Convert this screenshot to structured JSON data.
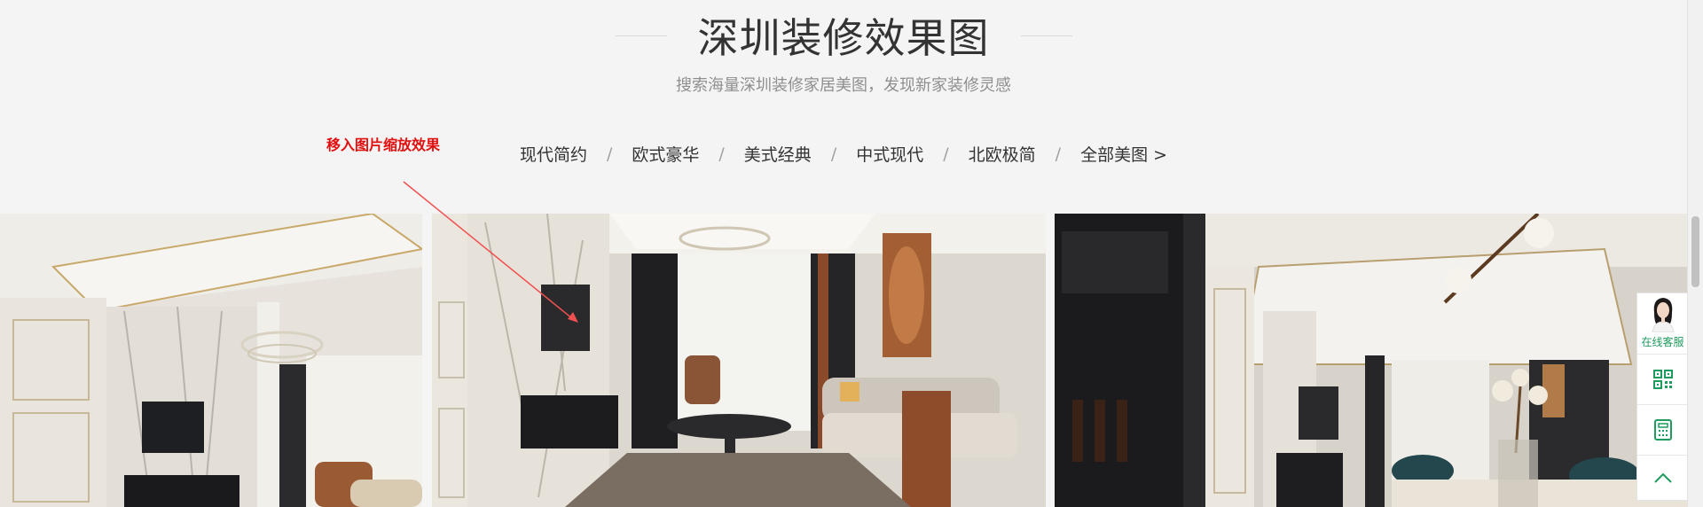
{
  "section": {
    "title": "深圳装修效果图",
    "subtitle": "搜索海量深圳装修家居美图，发现新家装修灵感"
  },
  "annotation": {
    "text": "移入图片缩放效果"
  },
  "nav": {
    "items": [
      {
        "label": "现代简约"
      },
      {
        "label": "欧式豪华"
      },
      {
        "label": "美式经典"
      },
      {
        "label": "中式现代"
      },
      {
        "label": "北欧极简"
      }
    ],
    "all_label": "全部美图 >",
    "separator": "/"
  },
  "gallery": {
    "images": [
      {
        "icon": "living-room-photo-1"
      },
      {
        "icon": "living-room-photo-2"
      },
      {
        "icon": "living-room-photo-3"
      }
    ]
  },
  "float_bar": {
    "service_label": "在线客服",
    "buttons": [
      {
        "icon": "qr-code-icon"
      },
      {
        "icon": "calculator-icon"
      },
      {
        "icon": "back-to-top-icon"
      }
    ]
  },
  "colors": {
    "accent_green": "#1e9c5e",
    "annotation_red": "#e10e0e"
  }
}
